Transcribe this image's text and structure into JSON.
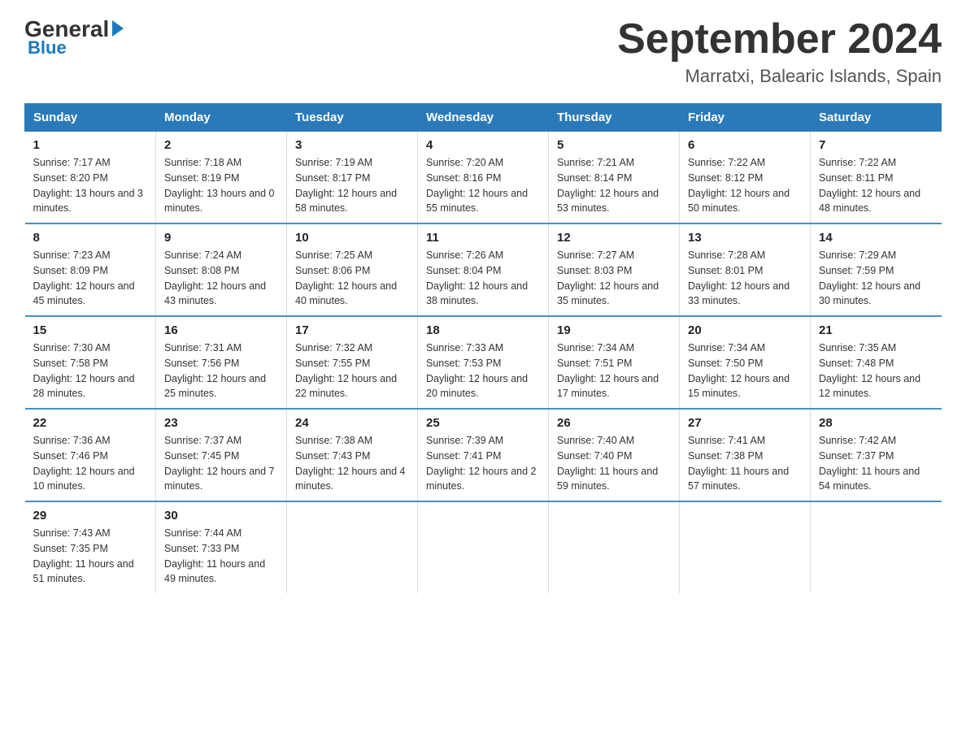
{
  "logo": {
    "general": "General",
    "blue": "Blue",
    "underline": "Blue"
  },
  "header": {
    "title": "September 2024",
    "subtitle": "Marratxi, Balearic Islands, Spain"
  },
  "days_of_week": [
    "Sunday",
    "Monday",
    "Tuesday",
    "Wednesday",
    "Thursday",
    "Friday",
    "Saturday"
  ],
  "weeks": [
    [
      {
        "day": "1",
        "sunrise": "Sunrise: 7:17 AM",
        "sunset": "Sunset: 8:20 PM",
        "daylight": "Daylight: 13 hours and 3 minutes."
      },
      {
        "day": "2",
        "sunrise": "Sunrise: 7:18 AM",
        "sunset": "Sunset: 8:19 PM",
        "daylight": "Daylight: 13 hours and 0 minutes."
      },
      {
        "day": "3",
        "sunrise": "Sunrise: 7:19 AM",
        "sunset": "Sunset: 8:17 PM",
        "daylight": "Daylight: 12 hours and 58 minutes."
      },
      {
        "day": "4",
        "sunrise": "Sunrise: 7:20 AM",
        "sunset": "Sunset: 8:16 PM",
        "daylight": "Daylight: 12 hours and 55 minutes."
      },
      {
        "day": "5",
        "sunrise": "Sunrise: 7:21 AM",
        "sunset": "Sunset: 8:14 PM",
        "daylight": "Daylight: 12 hours and 53 minutes."
      },
      {
        "day": "6",
        "sunrise": "Sunrise: 7:22 AM",
        "sunset": "Sunset: 8:12 PM",
        "daylight": "Daylight: 12 hours and 50 minutes."
      },
      {
        "day": "7",
        "sunrise": "Sunrise: 7:22 AM",
        "sunset": "Sunset: 8:11 PM",
        "daylight": "Daylight: 12 hours and 48 minutes."
      }
    ],
    [
      {
        "day": "8",
        "sunrise": "Sunrise: 7:23 AM",
        "sunset": "Sunset: 8:09 PM",
        "daylight": "Daylight: 12 hours and 45 minutes."
      },
      {
        "day": "9",
        "sunrise": "Sunrise: 7:24 AM",
        "sunset": "Sunset: 8:08 PM",
        "daylight": "Daylight: 12 hours and 43 minutes."
      },
      {
        "day": "10",
        "sunrise": "Sunrise: 7:25 AM",
        "sunset": "Sunset: 8:06 PM",
        "daylight": "Daylight: 12 hours and 40 minutes."
      },
      {
        "day": "11",
        "sunrise": "Sunrise: 7:26 AM",
        "sunset": "Sunset: 8:04 PM",
        "daylight": "Daylight: 12 hours and 38 minutes."
      },
      {
        "day": "12",
        "sunrise": "Sunrise: 7:27 AM",
        "sunset": "Sunset: 8:03 PM",
        "daylight": "Daylight: 12 hours and 35 minutes."
      },
      {
        "day": "13",
        "sunrise": "Sunrise: 7:28 AM",
        "sunset": "Sunset: 8:01 PM",
        "daylight": "Daylight: 12 hours and 33 minutes."
      },
      {
        "day": "14",
        "sunrise": "Sunrise: 7:29 AM",
        "sunset": "Sunset: 7:59 PM",
        "daylight": "Daylight: 12 hours and 30 minutes."
      }
    ],
    [
      {
        "day": "15",
        "sunrise": "Sunrise: 7:30 AM",
        "sunset": "Sunset: 7:58 PM",
        "daylight": "Daylight: 12 hours and 28 minutes."
      },
      {
        "day": "16",
        "sunrise": "Sunrise: 7:31 AM",
        "sunset": "Sunset: 7:56 PM",
        "daylight": "Daylight: 12 hours and 25 minutes."
      },
      {
        "day": "17",
        "sunrise": "Sunrise: 7:32 AM",
        "sunset": "Sunset: 7:55 PM",
        "daylight": "Daylight: 12 hours and 22 minutes."
      },
      {
        "day": "18",
        "sunrise": "Sunrise: 7:33 AM",
        "sunset": "Sunset: 7:53 PM",
        "daylight": "Daylight: 12 hours and 20 minutes."
      },
      {
        "day": "19",
        "sunrise": "Sunrise: 7:34 AM",
        "sunset": "Sunset: 7:51 PM",
        "daylight": "Daylight: 12 hours and 17 minutes."
      },
      {
        "day": "20",
        "sunrise": "Sunrise: 7:34 AM",
        "sunset": "Sunset: 7:50 PM",
        "daylight": "Daylight: 12 hours and 15 minutes."
      },
      {
        "day": "21",
        "sunrise": "Sunrise: 7:35 AM",
        "sunset": "Sunset: 7:48 PM",
        "daylight": "Daylight: 12 hours and 12 minutes."
      }
    ],
    [
      {
        "day": "22",
        "sunrise": "Sunrise: 7:36 AM",
        "sunset": "Sunset: 7:46 PM",
        "daylight": "Daylight: 12 hours and 10 minutes."
      },
      {
        "day": "23",
        "sunrise": "Sunrise: 7:37 AM",
        "sunset": "Sunset: 7:45 PM",
        "daylight": "Daylight: 12 hours and 7 minutes."
      },
      {
        "day": "24",
        "sunrise": "Sunrise: 7:38 AM",
        "sunset": "Sunset: 7:43 PM",
        "daylight": "Daylight: 12 hours and 4 minutes."
      },
      {
        "day": "25",
        "sunrise": "Sunrise: 7:39 AM",
        "sunset": "Sunset: 7:41 PM",
        "daylight": "Daylight: 12 hours and 2 minutes."
      },
      {
        "day": "26",
        "sunrise": "Sunrise: 7:40 AM",
        "sunset": "Sunset: 7:40 PM",
        "daylight": "Daylight: 11 hours and 59 minutes."
      },
      {
        "day": "27",
        "sunrise": "Sunrise: 7:41 AM",
        "sunset": "Sunset: 7:38 PM",
        "daylight": "Daylight: 11 hours and 57 minutes."
      },
      {
        "day": "28",
        "sunrise": "Sunrise: 7:42 AM",
        "sunset": "Sunset: 7:37 PM",
        "daylight": "Daylight: 11 hours and 54 minutes."
      }
    ],
    [
      {
        "day": "29",
        "sunrise": "Sunrise: 7:43 AM",
        "sunset": "Sunset: 7:35 PM",
        "daylight": "Daylight: 11 hours and 51 minutes."
      },
      {
        "day": "30",
        "sunrise": "Sunrise: 7:44 AM",
        "sunset": "Sunset: 7:33 PM",
        "daylight": "Daylight: 11 hours and 49 minutes."
      },
      null,
      null,
      null,
      null,
      null
    ]
  ]
}
